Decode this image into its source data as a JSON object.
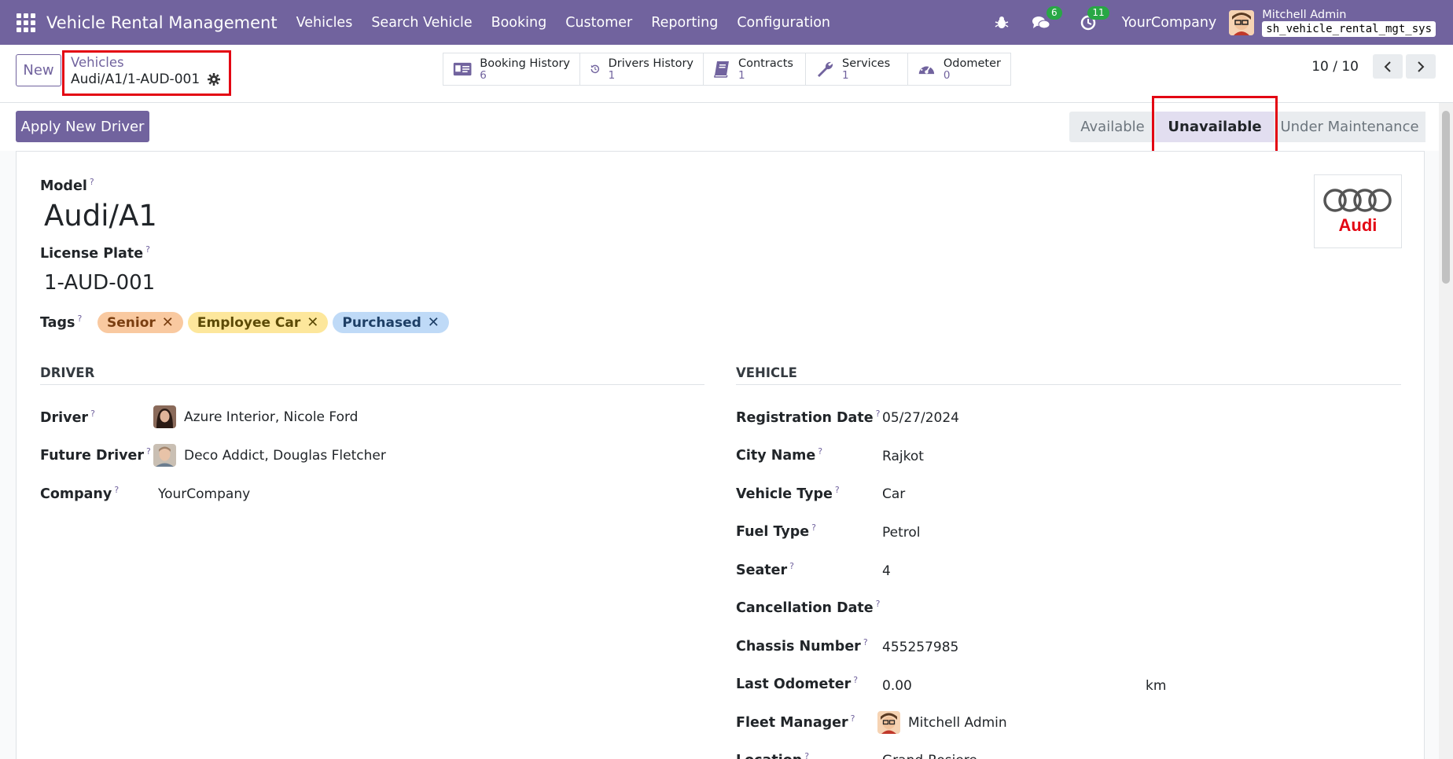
{
  "navbar": {
    "brand": "Vehicle Rental Management",
    "menu": [
      "Vehicles",
      "Search Vehicle",
      "Booking",
      "Customer",
      "Reporting",
      "Configuration"
    ],
    "chat_count": "6",
    "activity_count": "11",
    "company": "YourCompany",
    "user_name": "Mitchell Admin",
    "db_name": "sh_vehicle_rental_mgt_sys"
  },
  "control": {
    "new_label": "New",
    "breadcrumb_parent": "Vehicles",
    "breadcrumb_current": "Audi/A1/1-AUD-001",
    "smart_buttons": [
      {
        "label": "Booking History",
        "value": "6",
        "icon": "id-card-icon"
      },
      {
        "label": "Drivers History",
        "value": "1",
        "icon": "history-icon"
      },
      {
        "label": "Contracts",
        "value": "1",
        "icon": "book-icon"
      },
      {
        "label": "Services",
        "value": "1",
        "icon": "wrench-icon"
      },
      {
        "label": "Odometer",
        "value": "0",
        "icon": "tachometer-icon"
      }
    ],
    "pager": "10 / 10"
  },
  "actions": {
    "apply_new_driver": "Apply New Driver",
    "status": [
      "Available",
      "Unavailable",
      "Under Maintenance"
    ],
    "active_status": "Unavailable"
  },
  "form": {
    "model_label": "Model",
    "model_value": "Audi/A1",
    "license_plate_label": "License Plate",
    "license_plate_value": "1-AUD-001",
    "logo_text": "Audi",
    "tags_label": "Tags",
    "tags": [
      {
        "name": "Senior",
        "color": "#f9c9a0"
      },
      {
        "name": "Employee Car",
        "color": "#fde79c"
      },
      {
        "name": "Purchased",
        "color": "#bfdaf7"
      }
    ],
    "driver_section": {
      "title": "DRIVER",
      "fields": [
        {
          "label": "Driver",
          "value": "Azure Interior, Nicole Ford"
        },
        {
          "label": "Future Driver",
          "value": "Deco Addict, Douglas Fletcher"
        },
        {
          "label": "Company",
          "value": "YourCompany"
        }
      ]
    },
    "vehicle_section": {
      "title": "VEHICLE",
      "fields": [
        {
          "label": "Registration Date",
          "value": "05/27/2024"
        },
        {
          "label": "City Name",
          "value": "Rajkot"
        },
        {
          "label": "Vehicle Type",
          "value": "Car"
        },
        {
          "label": "Fuel Type",
          "value": "Petrol"
        },
        {
          "label": "Seater",
          "value": "4"
        },
        {
          "label": "Cancellation Date",
          "value": ""
        },
        {
          "label": "Chassis Number",
          "value": "455257985"
        },
        {
          "label": "Last Odometer",
          "value": "0.00",
          "unit": "km"
        },
        {
          "label": "Fleet Manager",
          "value": "Mitchell Admin"
        },
        {
          "label": "Location",
          "value": "Grand-Rosiere"
        }
      ]
    },
    "help_mark": "?"
  },
  "colors": {
    "brand": "#71639e",
    "highlight": "#e30613"
  }
}
